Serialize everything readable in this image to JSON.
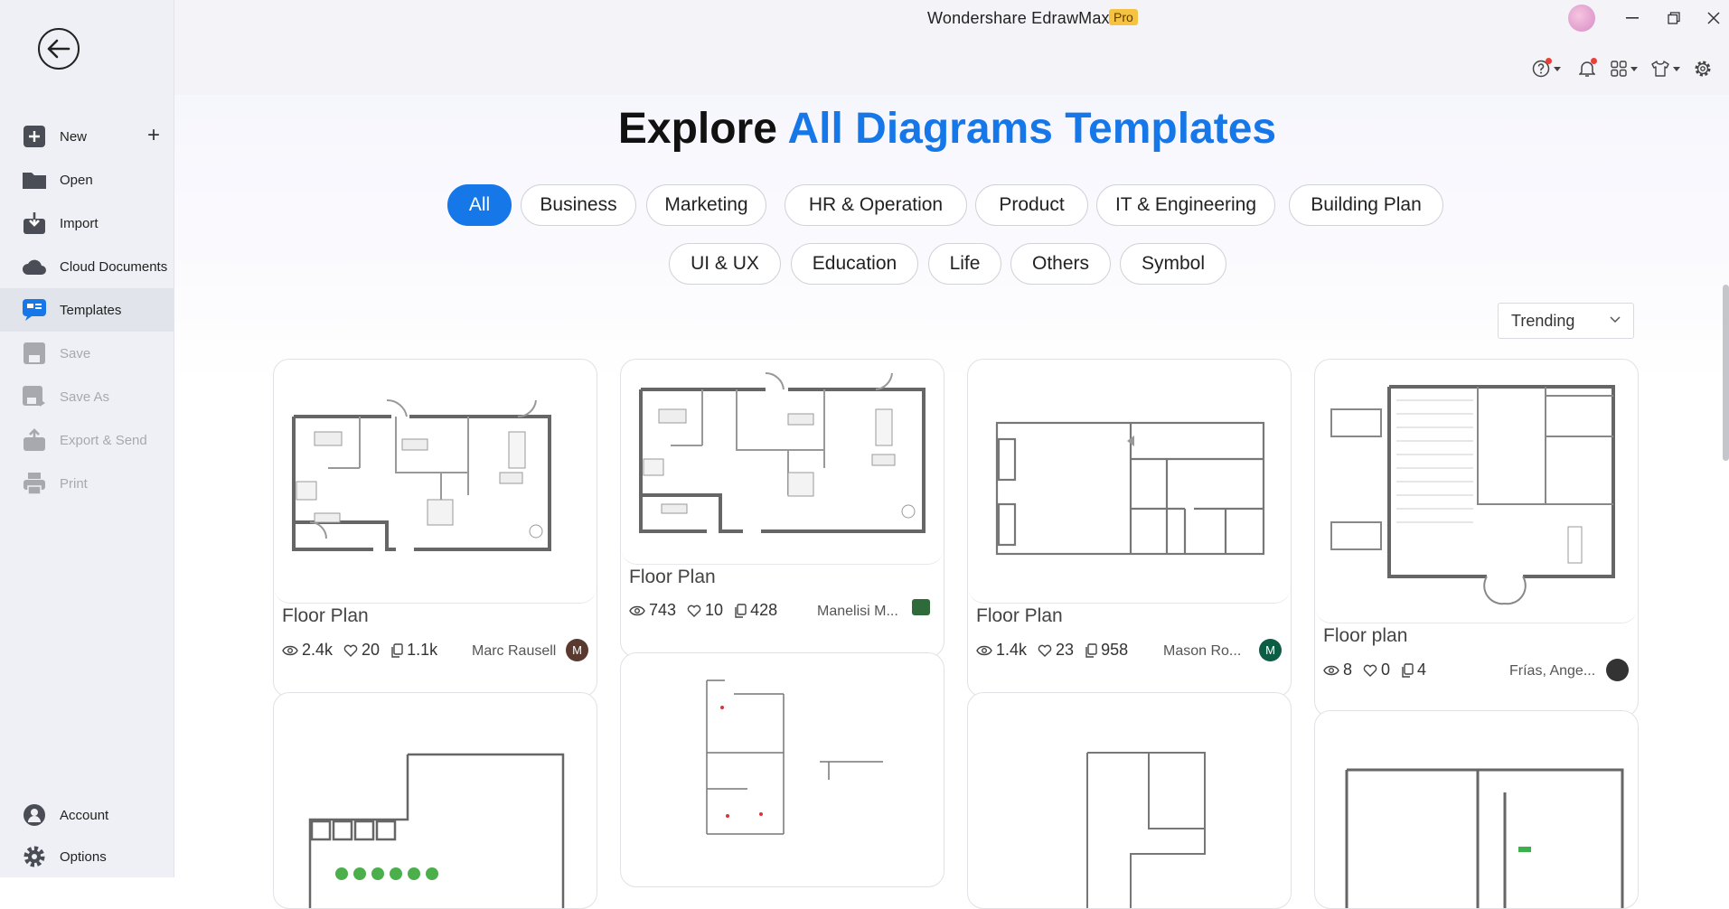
{
  "window": {
    "title": "Wondershare EdrawMax",
    "badge": "Pro"
  },
  "sidebar": {
    "items": [
      {
        "label": "New",
        "icon": "new-file-icon"
      },
      {
        "label": "Open",
        "icon": "folder-icon"
      },
      {
        "label": "Import",
        "icon": "import-icon"
      },
      {
        "label": "Cloud Documents",
        "icon": "cloud-icon"
      },
      {
        "label": "Templates",
        "icon": "templates-icon",
        "active": true
      },
      {
        "label": "Save",
        "icon": "save-icon",
        "disabled": true
      },
      {
        "label": "Save As",
        "icon": "save-as-icon",
        "disabled": true
      },
      {
        "label": "Export & Send",
        "icon": "export-icon",
        "disabled": true
      },
      {
        "label": "Print",
        "icon": "print-icon",
        "disabled": true
      }
    ],
    "bottom": [
      {
        "label": "Account",
        "icon": "account-icon"
      },
      {
        "label": "Options",
        "icon": "gear-icon"
      }
    ]
  },
  "header": {
    "title_part1": "Explore",
    "title_part2": "All Diagrams Templates"
  },
  "categories": [
    "All",
    "Business",
    "Marketing",
    "HR & Operation",
    "Product",
    "IT & Engineering",
    "Building Plan",
    "UI & UX",
    "Education",
    "Life",
    "Others",
    "Symbol"
  ],
  "sort": {
    "selected": "Trending"
  },
  "templates": [
    {
      "title": "Floor Plan",
      "views": "2.4k",
      "likes": "20",
      "copies": "1.1k",
      "author": "Marc Rausell",
      "avatar_letter": "M",
      "avatar_color": "#5a3a2e"
    },
    {
      "title": "Floor Plan",
      "views": "743",
      "likes": "10",
      "copies": "428",
      "author": "Manelisi M...",
      "avatar_letter": "",
      "avatar_color": "#2f6b3a"
    },
    {
      "title": "Floor Plan",
      "views": "1.4k",
      "likes": "23",
      "copies": "958",
      "author": "Mason Ro...",
      "avatar_letter": "M",
      "avatar_color": "#0d5c44"
    },
    {
      "title": "Floor plan",
      "views": "8",
      "likes": "0",
      "copies": "4",
      "author": "Frías, Ange...",
      "avatar_letter": "",
      "avatar_color": "#333333"
    }
  ],
  "colors": {
    "accent": "#1677e8",
    "pro_badge": "#f5c242",
    "notification": "#e9403a"
  }
}
